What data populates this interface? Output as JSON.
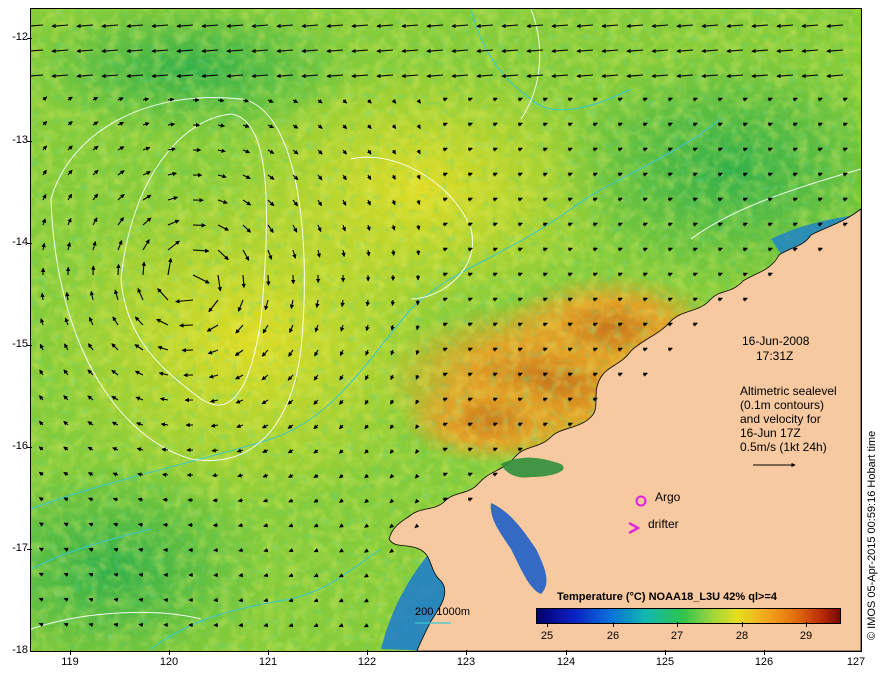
{
  "map": {
    "y_axis_labels": [
      "-12",
      "-13",
      "-14",
      "-15",
      "-16",
      "-17",
      "-18"
    ],
    "x_axis_labels": [
      "119",
      "120",
      "121",
      "122",
      "123",
      "124",
      "125",
      "126",
      "127"
    ],
    "date": "16-Jun-2008",
    "time": "17:31Z",
    "altimetry_text": [
      "Altimetric sealevel",
      "(0.1m contours)",
      "and velocity for",
      "16-Jun 17Z",
      "0.5m/s (1kt 24h)"
    ],
    "argo_label": "Argo",
    "drifter_label": "drifter",
    "isobath_label": "200  1000m",
    "credit": "© IMOS 05-Apr-2015 00:59:16 Hobart time"
  },
  "colorbar": {
    "title": "Temperature (°C) NOAA18_L3U 42% ql>=4",
    "ticks": [
      "25",
      "26",
      "27",
      "28",
      "29"
    ]
  },
  "colors": {
    "land": "#f6c9a0",
    "sea_base": "#7cc93c",
    "warm": "#e08a22",
    "argo_marker": "#e020e0",
    "contour": "#ffffff",
    "isobath": "#3ad0d0"
  },
  "icons": {
    "argo": "circle-marker",
    "drifter": "chevron-marker"
  }
}
